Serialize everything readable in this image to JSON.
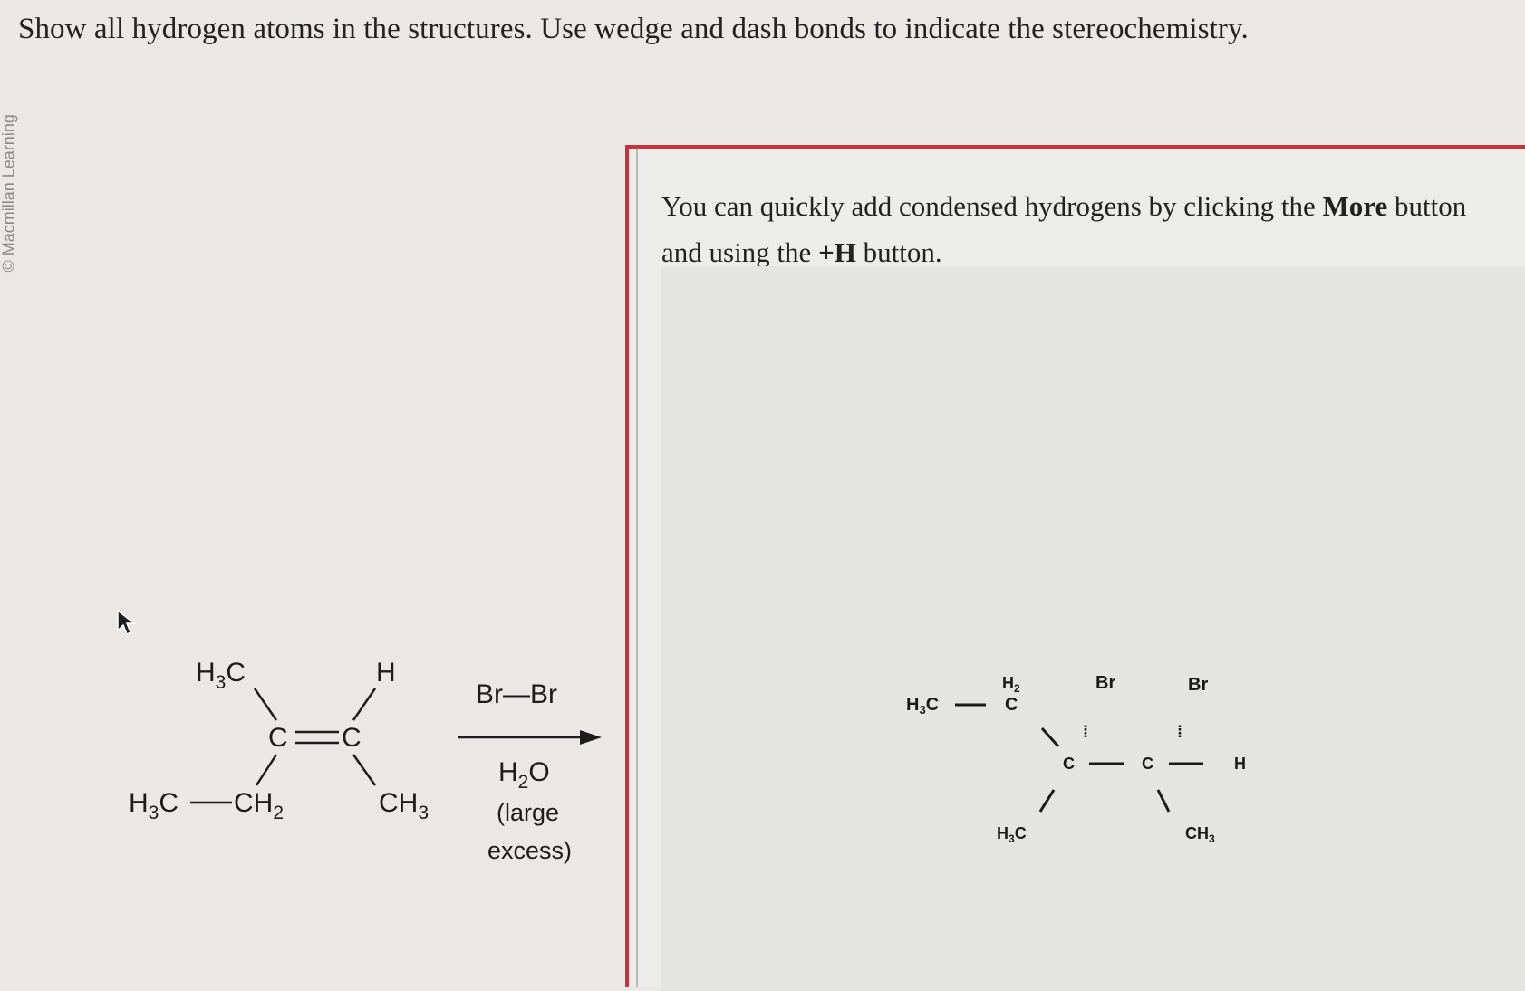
{
  "instruction": "Show all hydrogen atoms in the structures. Use wedge and dash bonds to indicate the stereochemistry.",
  "watermark": "© Macmillan Learning",
  "reactant": {
    "top_left": "H3C",
    "top_right": "H",
    "carbon": "C",
    "bottom_left_methyl": "H3C",
    "bottom_left_ch2": "CH2",
    "bottom_right": "CH3"
  },
  "reagents": {
    "above_arrow": "Br—Br",
    "below_arrow_1": "H2O",
    "below_arrow_2": "(large",
    "below_arrow_3": "excess)"
  },
  "hint": {
    "part1": "You can quickly add condensed hydrogens by clicking the ",
    "more": "More",
    "part2": " button",
    "line2a": "and using the ",
    "plus_h": "+H",
    "line2b": " button."
  },
  "product": {
    "h3c_left": "H3C",
    "h2": "H2",
    "c_top": "C",
    "br1": "Br",
    "br2": "Br",
    "c_center1": "C",
    "c_center2": "C",
    "h_right": "H",
    "h3c_bottom": "H3C",
    "ch3_bottom": "CH3"
  }
}
